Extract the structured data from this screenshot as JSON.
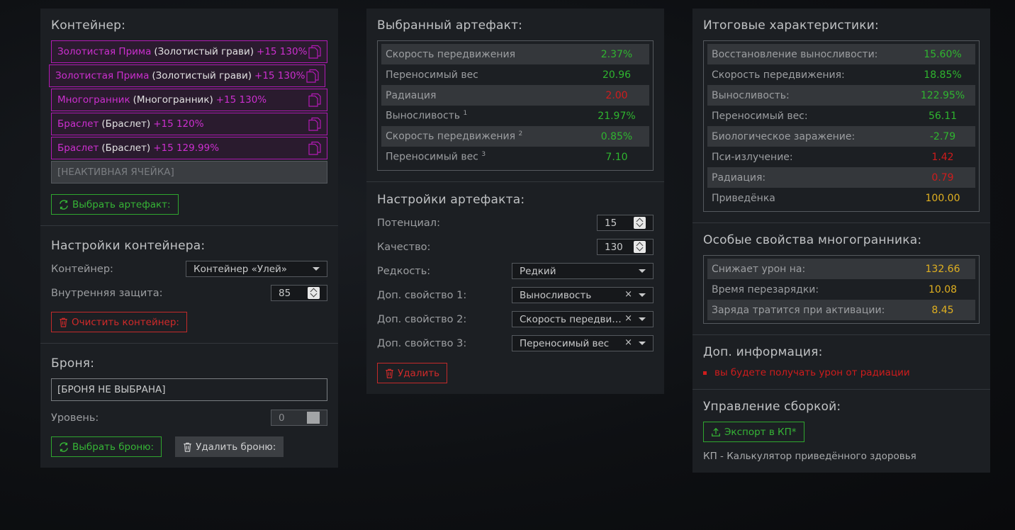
{
  "container": {
    "title": "Контейнер:",
    "slots": [
      {
        "name": "Золотистая Прима",
        "base": "(Золотистый грави)",
        "level": "+15 130%"
      },
      {
        "name": "Золотистая Прима",
        "base": "(Золотистый грави)",
        "level": "+15 130%"
      },
      {
        "name": "Многогранник",
        "base": "(Многогранник)",
        "level": "+15 130%"
      },
      {
        "name": "Браслет",
        "base": "(Браслет)",
        "level": "+15 120%"
      },
      {
        "name": "Браслет",
        "base": "(Браслет)",
        "level": "+15 129.99%"
      }
    ],
    "inactive_slot": "[НЕАКТИВНАЯ ЯЧЕЙКА]",
    "select_button": "Выбрать артефакт:"
  },
  "container_settings": {
    "title": "Настройки контейнера:",
    "container_label": "Контейнер:",
    "container_value": "Контейнер «Улей»",
    "protection_label": "Внутренняя защита:",
    "protection_value": "85",
    "clear_button": "Очистить контейнер:"
  },
  "armor": {
    "title": "Броня:",
    "value": "[БРОНЯ НЕ ВЫБРАНА]",
    "level_label": "Уровень:",
    "level_value": "0",
    "select_button": "Выбрать броню:",
    "delete_button": "Удалить броню:"
  },
  "selected_artifact": {
    "title": "Выбранный артефакт:",
    "stats": [
      {
        "label": "Скорость передвижения",
        "sup": "",
        "value": "2.37%",
        "color": "g"
      },
      {
        "label": "Переносимый вес",
        "sup": "",
        "value": "20.96",
        "color": "g"
      },
      {
        "label": "Радиация",
        "sup": "",
        "value": "2.00",
        "color": "r"
      },
      {
        "label": "Выносливость",
        "sup": "1",
        "value": "21.97%",
        "color": "g"
      },
      {
        "label": "Скорость передвижения",
        "sup": "2",
        "value": "0.85%",
        "color": "g"
      },
      {
        "label": "Переносимый вес",
        "sup": "3",
        "value": "7.10",
        "color": "g"
      }
    ]
  },
  "artifact_settings": {
    "title": "Настройки артефакта:",
    "potential_label": "Потенциал:",
    "potential_value": "15",
    "quality_label": "Качество:",
    "quality_value": "130",
    "rarity_label": "Редкость:",
    "rarity_value": "Редкий",
    "prop1_label": "Доп. свойство 1:",
    "prop1_value": "Выносливость",
    "prop2_label": "Доп. свойство 2:",
    "prop2_value": "Скорость передвижения",
    "prop3_label": "Доп. свойство 3:",
    "prop3_value": "Переносимый вес",
    "clear_glyph": "×",
    "delete_button": "Удалить"
  },
  "totals": {
    "title": "Итоговые характеристики:",
    "stats": [
      {
        "label": "Восстановление выносливости:",
        "value": "15.60%",
        "color": "g"
      },
      {
        "label": "Скорость передвижения:",
        "value": "18.85%",
        "color": "g"
      },
      {
        "label": "Выносливость:",
        "value": "122.95%",
        "color": "g"
      },
      {
        "label": "Переносимый вес:",
        "value": "56.11",
        "color": "g"
      },
      {
        "label": "Биологическое заражение:",
        "value": "-2.79",
        "color": "g"
      },
      {
        "label": "Пси-излучение:",
        "value": "1.42",
        "color": "r"
      },
      {
        "label": "Радиация:",
        "value": "0.79",
        "color": "r"
      },
      {
        "label": "Приведёнка",
        "value": "100.00",
        "color": "y"
      }
    ]
  },
  "special": {
    "title": "Особые свойства многогранника:",
    "stats": [
      {
        "label": "Снижает урон на:",
        "value": "132.66",
        "color": "y"
      },
      {
        "label": "Время перезарядки:",
        "value": "10.08",
        "color": "y"
      },
      {
        "label": "Заряда тратится при активации:",
        "value": "8.45",
        "color": "y"
      }
    ]
  },
  "info": {
    "title": "Доп. информация:",
    "items": [
      "вы будете получать урон от радиации"
    ]
  },
  "build": {
    "title": "Управление сборкой:",
    "export_button": "Экспорт в КП*",
    "note": "КП - Калькулятор приведённого здоровья"
  },
  "colors": {
    "green": "#2fb52f",
    "red": "#d01c1c",
    "yellow": "#e0b020",
    "purple": "#cc2fcf"
  }
}
